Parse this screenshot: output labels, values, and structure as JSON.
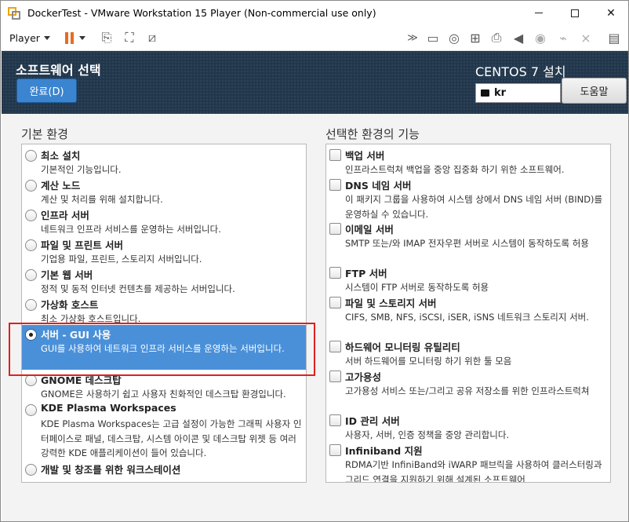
{
  "window": {
    "title": "DockerTest - VMware Workstation 15 Player (Non-commercial use only)"
  },
  "toolbar": {
    "player_menu": "Player",
    "icons_left": [
      "pause-icon",
      "dropdown-caret-icon",
      "send-ctrl-alt-del-icon",
      "fullscreen-icon",
      "unity-icon"
    ],
    "icons_right": [
      "expand-icon",
      "hard-disk-icon",
      "cd-dvd-icon",
      "network-icon",
      "printer-icon",
      "sound-icon",
      "camera-icon",
      "usb-icon",
      "message-icon"
    ],
    "accent": "#ea6a20"
  },
  "installer": {
    "page_title": "소프트웨어 선택",
    "done_button": "완료(D)",
    "product_title": "CENTOS 7 설치",
    "keyboard_layout": "kr",
    "help_button": "도움말",
    "header_color": "#23374c",
    "button_color": "#3b84d0"
  },
  "base_environment": {
    "heading": "기본 환경",
    "items": [
      {
        "name": "최소 설치",
        "desc": "기본적인 기능입니다.",
        "selected": false
      },
      {
        "name": "계산 노드",
        "desc": "계산 및 처리를 위해 설치합니다.",
        "selected": false
      },
      {
        "name": "인프라 서버",
        "desc": "네트워크 인프라 서비스를 운영하는 서버입니다.",
        "selected": false
      },
      {
        "name": "파일 및 프린트 서버",
        "desc": "기업용 파일, 프린트, 스토리지 서버입니다.",
        "selected": false
      },
      {
        "name": "기본 웹 서버",
        "desc": "정적 및 동적 인터넷 컨텐츠를 제공하는 서버입니다.",
        "selected": false
      },
      {
        "name": "가상화 호스트",
        "desc": "최소 가상화 호스트입니다.",
        "selected": false
      },
      {
        "name": "서버 - GUI 사용",
        "desc": "GUI를 사용하여 네트워크 인프라 서비스를 운영하는 서버입니다.",
        "selected": true
      },
      {
        "name": "GNOME 데스크탑",
        "desc": "GNOME은 사용하기 쉽고 사용자 친화적인 데스크탑 환경입니다.",
        "selected": false
      },
      {
        "name": "KDE Plasma Workspaces",
        "desc": "KDE Plasma Workspaces는 고급 설정이 가능한 그래픽 사용자 인터페이스로 패널, 데스크탑, 시스템 아이콘 및 데스크탑 위젯 등 여러 강력한 KDE 애플리케이션이 들어 있습니다.",
        "selected": false
      },
      {
        "name": "개발 및 창조를 위한 워크스테이션",
        "desc": "",
        "selected": false
      }
    ]
  },
  "addons": {
    "heading": "선택한 환경의 기능",
    "items": [
      {
        "name": "백업 서버",
        "desc": "인프라스트럭쳐 백업을 중앙 집중화 하기 위한 소프트웨어.",
        "checked": false
      },
      {
        "name": "DNS 네임 서버",
        "desc": "이 패키지 그룹을 사용하여 시스템 상에서 DNS 네임 서버 (BIND)를 운영하실 수 있습니다.",
        "checked": false
      },
      {
        "name": "이메일 서버",
        "desc": "SMTP 또는/와 IMAP 전자우편 서버로 시스템이 동작하도록 허용",
        "checked": false
      },
      {
        "name": "FTP 서버",
        "desc": "시스템이 FTP 서버로 동작하도록 허용",
        "checked": false
      },
      {
        "name": "파일 및 스토리지 서버",
        "desc": "CIFS, SMB, NFS, iSCSI, iSER, iSNS 네트워크 스토리지 서버.",
        "checked": false
      },
      {
        "name": "하드웨어 모니터링 유틸리티",
        "desc": "서버 하드웨어를 모니터링 하기 위한 툴 모음",
        "checked": false
      },
      {
        "name": "고가용성",
        "desc": "고가용성 서비스 또는/그리고 공유 저장소를 위한 인프라스트럭쳐",
        "checked": false
      },
      {
        "name": "ID 관리 서버",
        "desc": "사용자, 서버, 인증 정책을 중앙 관리합니다.",
        "checked": false
      },
      {
        "name": "Infiniband 지원",
        "desc": "RDMA기반 InfiniBand와 iWARP 패브릭을 사용하여 클러스터링과 그리드 연결을 지원하기 위해 설계된 소프트웨어",
        "checked": false
      }
    ]
  }
}
